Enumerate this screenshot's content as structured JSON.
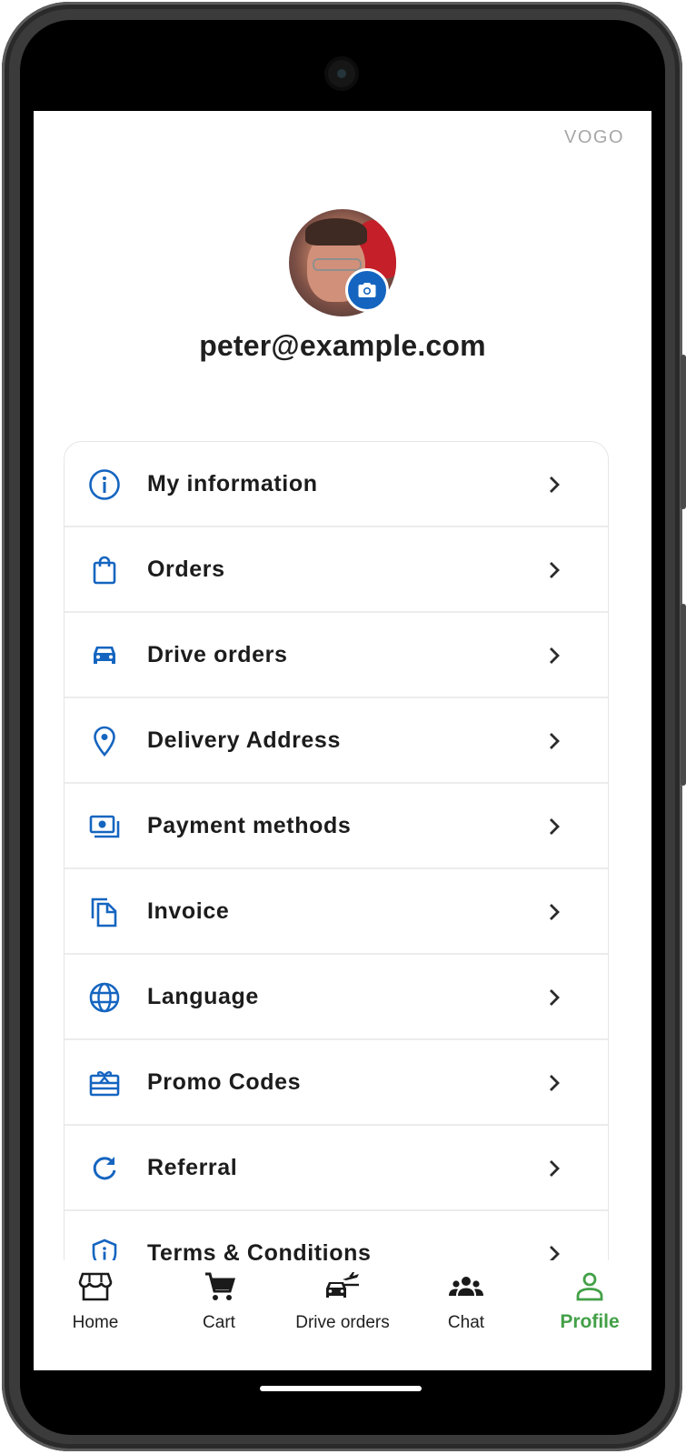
{
  "app": {
    "brand": "VOGO"
  },
  "profile": {
    "email": "peter@example.com",
    "avatar_icon": "user-photo",
    "camera_icon": "camera-icon"
  },
  "colors": {
    "accent": "#1565c0",
    "active_nav": "#43a047",
    "text": "#1f1f1f"
  },
  "menu": {
    "items": [
      {
        "label": "My information",
        "icon": "info-icon"
      },
      {
        "label": "Orders",
        "icon": "shopping-bag-icon"
      },
      {
        "label": "Drive orders",
        "icon": "car-icon"
      },
      {
        "label": "Delivery Address",
        "icon": "location-pin-icon"
      },
      {
        "label": "Payment methods",
        "icon": "payments-icon"
      },
      {
        "label": "Invoice",
        "icon": "documents-icon"
      },
      {
        "label": "Language",
        "icon": "globe-icon"
      },
      {
        "label": "Promo Codes",
        "icon": "gift-card-icon"
      },
      {
        "label": "Referral",
        "icon": "refresh-icon"
      },
      {
        "label": "Terms & Conditions",
        "icon": "shield-info-icon"
      }
    ]
  },
  "bottom_nav": {
    "items": [
      {
        "label": "Home",
        "icon": "store-icon",
        "active": false
      },
      {
        "label": "Cart",
        "icon": "cart-icon",
        "active": false
      },
      {
        "label": "Drive orders",
        "icon": "car-plane-icon",
        "active": false
      },
      {
        "label": "Chat",
        "icon": "group-icon",
        "active": false
      },
      {
        "label": "Profile",
        "icon": "person-icon",
        "active": true
      }
    ]
  }
}
